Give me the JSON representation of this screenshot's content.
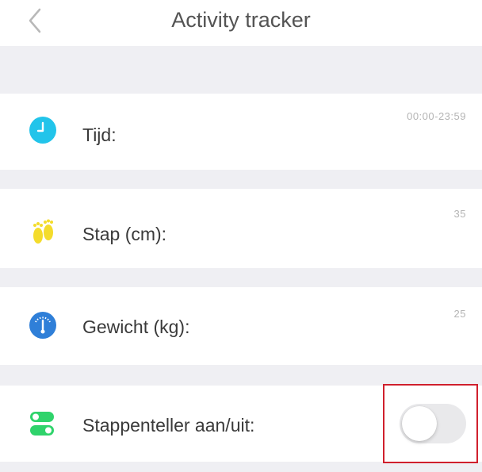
{
  "header": {
    "title": "Activity tracker",
    "back_icon": "chevron-left-icon"
  },
  "settings": [
    {
      "label": "Tijd:",
      "value": "00:00-23:59",
      "icon": "clock-icon",
      "icon_color": "#22c4ea"
    },
    {
      "label": "Stap (cm):",
      "value": "35",
      "icon": "footprints-icon",
      "icon_color": "#f4dc2c"
    },
    {
      "label": "Gewicht (kg):",
      "value": "25",
      "icon": "scale-icon",
      "icon_color": "#2f7fd8"
    },
    {
      "label": "Stappenteller aan/uit:",
      "icon": "toggle-switch-icon",
      "icon_color": "#2fd36b",
      "toggle_on": false
    }
  ],
  "colors": {
    "separator": "#efeff3",
    "highlight": "#d0202d"
  }
}
